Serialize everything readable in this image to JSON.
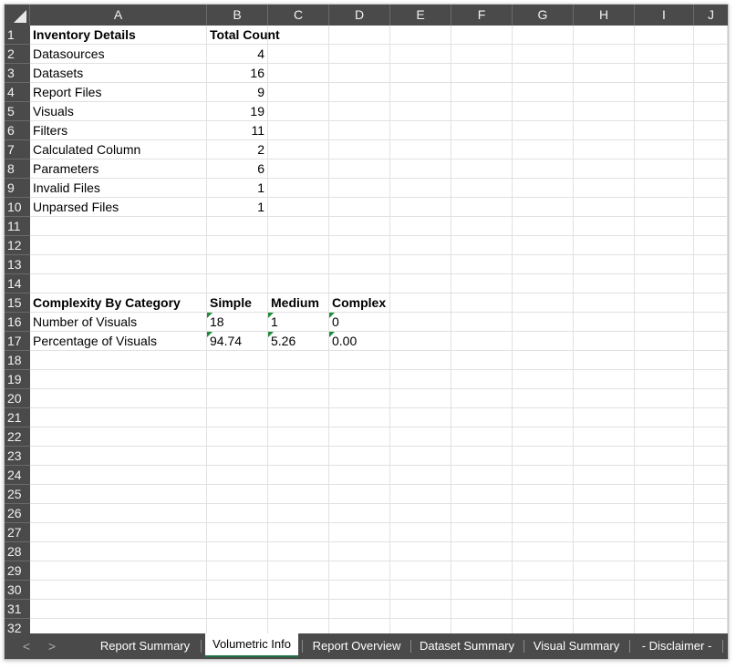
{
  "columns": [
    "A",
    "B",
    "C",
    "D",
    "E",
    "F",
    "G",
    "H",
    "I",
    "J"
  ],
  "rows": [
    "1",
    "2",
    "3",
    "4",
    "5",
    "6",
    "7",
    "8",
    "9",
    "10",
    "11",
    "12",
    "13",
    "14",
    "15",
    "16",
    "17",
    "18",
    "19",
    "20",
    "21",
    "22",
    "23",
    "24",
    "25",
    "26",
    "27",
    "28",
    "29",
    "30",
    "31",
    "32"
  ],
  "cells": {
    "A1": "Inventory Details",
    "B1": "Total Count",
    "A2": "Datasources",
    "B2": "4",
    "A3": "Datasets",
    "B3": "16",
    "A4": "Report Files",
    "B4": "9",
    "A5": "Visuals",
    "B5": "19",
    "A6": "Filters",
    "B6": "11",
    "A7": "Calculated Column",
    "B7": "2",
    "A8": "Parameters",
    "B8": "6",
    "A9": "Invalid Files",
    "B9": "1",
    "A10": "Unparsed Files",
    "B10": "1",
    "A15": "Complexity By Category",
    "B15": "Simple",
    "C15": "Medium",
    "D15": "Complex",
    "A16": "Number of Visuals",
    "B16": "18",
    "C16": "1",
    "D16": "0",
    "A17": "Percentage of Visuals",
    "B17": "94.74",
    "C17": "5.26",
    "D17": "0.00"
  },
  "tabs": {
    "nav_prev": "<",
    "nav_next": ">",
    "sheets": [
      "Report Summary",
      "Volumetric Info",
      "Report Overview",
      "Dataset Summary",
      "Visual Summary",
      "- Disclaimer -"
    ],
    "active": "Volumetric Info"
  },
  "colors": {
    "header_bg": "#4a4a4a",
    "gridline": "#e1e1e1",
    "error_flag": "#1e8c3a",
    "active_tab_underline": "#1e7145"
  }
}
